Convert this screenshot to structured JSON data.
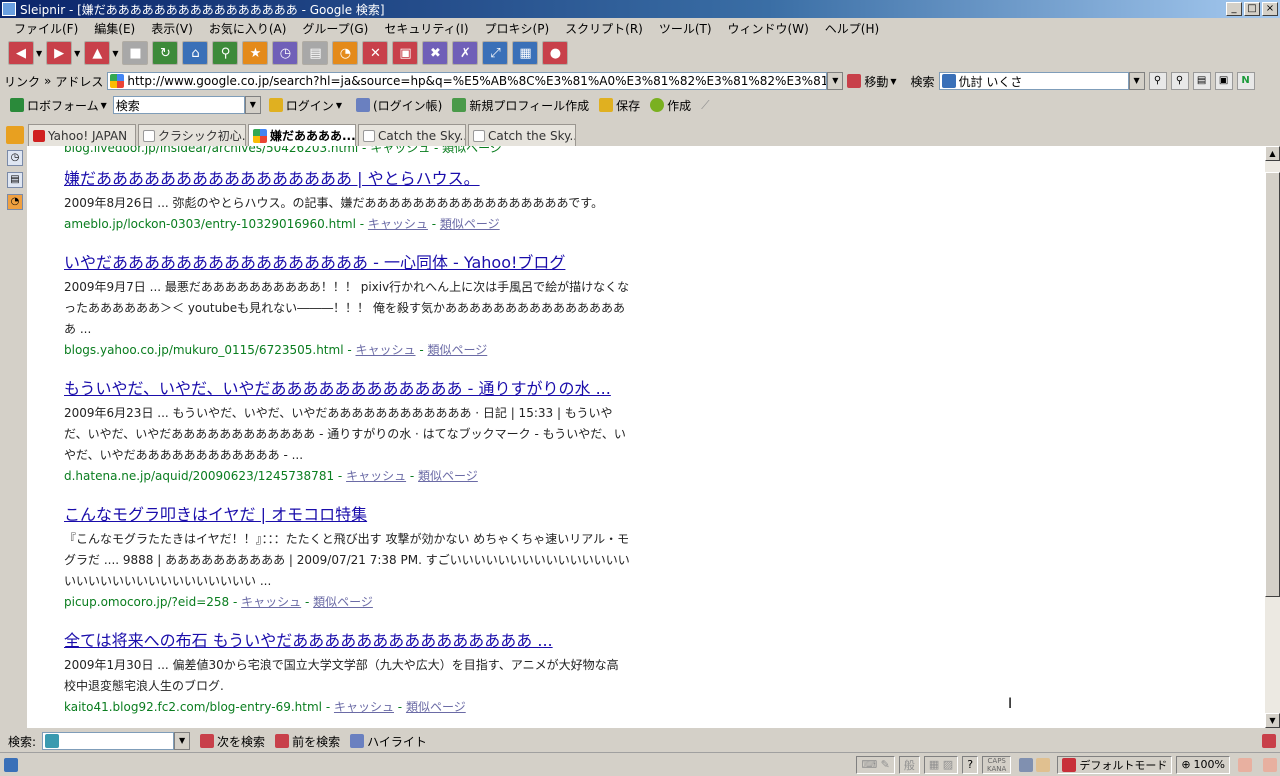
{
  "window": {
    "title": "Sleipnir - [嫌だああああああああああああああああ - Google 検索]",
    "controls": [
      "_",
      "□",
      "×"
    ]
  },
  "menu": [
    "ファイル(F)",
    "編集(E)",
    "表示(V)",
    "お気に入り(A)",
    "グループ(G)",
    "セキュリティ(I)",
    "プロキシ(P)",
    "スクリプト(R)",
    "ツール(T)",
    "ウィンドウ(W)",
    "ヘルプ(H)"
  ],
  "address": {
    "links_label": "リンク",
    "address_label": "アドレス",
    "url": "http://www.google.co.jp/search?hl=ja&source=hp&q=%E5%AB%8C%E3%81%A0%E3%81%82%E3%81%82%E3%81%82%E3%81%82%E3%81%82%E3%81%82%E3%81%82%E3%81%82",
    "go_label": "移動",
    "search_label": "検索",
    "search_value": "仇討  いくさ"
  },
  "formbar": {
    "roboform": "ロボフォーム",
    "search_value": "検索",
    "login": "ログイン",
    "login_book": "(ログイン帳)",
    "new_profile": "新規プロフィール作成",
    "save": "保存",
    "create": "作成"
  },
  "tabs": [
    {
      "label": "Yahoo! JAPAN",
      "active": false
    },
    {
      "label": "クラシック初心...",
      "active": false
    },
    {
      "label": "嫌だああああ...",
      "active": true
    },
    {
      "label": "Catch the Sky...",
      "active": false
    },
    {
      "label": "Catch the Sky...",
      "active": false
    }
  ],
  "partial_top_url": "blog.livedoor.jp/insidear/archives/50426203.html - キャッシュ - 類似ページ",
  "results": [
    {
      "title": "嫌だああああああああああああああああ | やとらハウス。",
      "snippet": "2009年8月26日 ... 弥彪のやとらハウス。の記事、嫌だあああああああああああああああああです。",
      "url": "ameblo.jp/lockon-0303/entry-10329016960.html",
      "cache": "キャッシュ",
      "similar": "類似ページ"
    },
    {
      "title": "いやだああああああああああああああああ - 一心同体 - Yahoo!ブログ",
      "snippet": "2009年9月7日 ... 最悪だああああああああああ！！！ pixiv行かれへん上に次は手風呂で絵が描けなくなったああああああ＞＜ youtubeも見れない―――！！！ 俺を殺す気かああああああああああああああああ ...",
      "url": "blogs.yahoo.co.jp/mukuro_0115/6723505.html",
      "cache": "キャッシュ",
      "similar": "類似ページ"
    },
    {
      "title": "もういやだ、いやだ、いやだああああああああああああ - 通りすがりの水 ...",
      "snippet": "2009年6月23日 ... もういやだ、いやだ、いやだああああああああああああ · 日記 | 15:33 | もういやだ、いやだ、いやだああああああああああああ - 通りすがりの水 · はてなブックマーク - もういやだ、いやだ、いやだああああああああああああ - ...",
      "url": "d.hatena.ne.jp/aquid/20090623/1245738781",
      "cache": "キャッシュ",
      "similar": "類似ページ"
    },
    {
      "title": "こんなモグラ叩きはイヤだ | オモコロ特集",
      "snippet": "『こんなモグラたたきはイヤだ！！』：：：たたくと飛び出す 攻撃が効かない めちゃくちゃ速いリアル・モグラだ .... 9888 | ああああああああああ | 2009/07/21 7:38 PM. すごいいいいいいいいいいいいいいいいいいいいいいいいいいいいいいい ...",
      "url": "picup.omocoro.jp/?eid=258",
      "cache": "キャッシュ",
      "similar": "類似ページ"
    },
    {
      "title": "全ては将来への布石 もういやだあああああああああああああああ ...",
      "snippet": "2009年1月30日 ... 偏差値30から宅浪で国立大学文学部（九大や広大）を目指す、アニメが大好物な高校中退変態宅浪人生のブログ.",
      "url": "kaito41.blog92.fc2.com/blog-entry-69.html",
      "cache": "キャッシュ",
      "similar": "類似ページ"
    }
  ],
  "findbar": {
    "label": "検索:",
    "next": "次を検索",
    "prev": "前を検索",
    "highlight": "ハイライト"
  },
  "status": {
    "caps": "CAPS",
    "kana": "KANA",
    "ime": "般",
    "mode": "デフォルトモード",
    "zoom": "100%"
  }
}
